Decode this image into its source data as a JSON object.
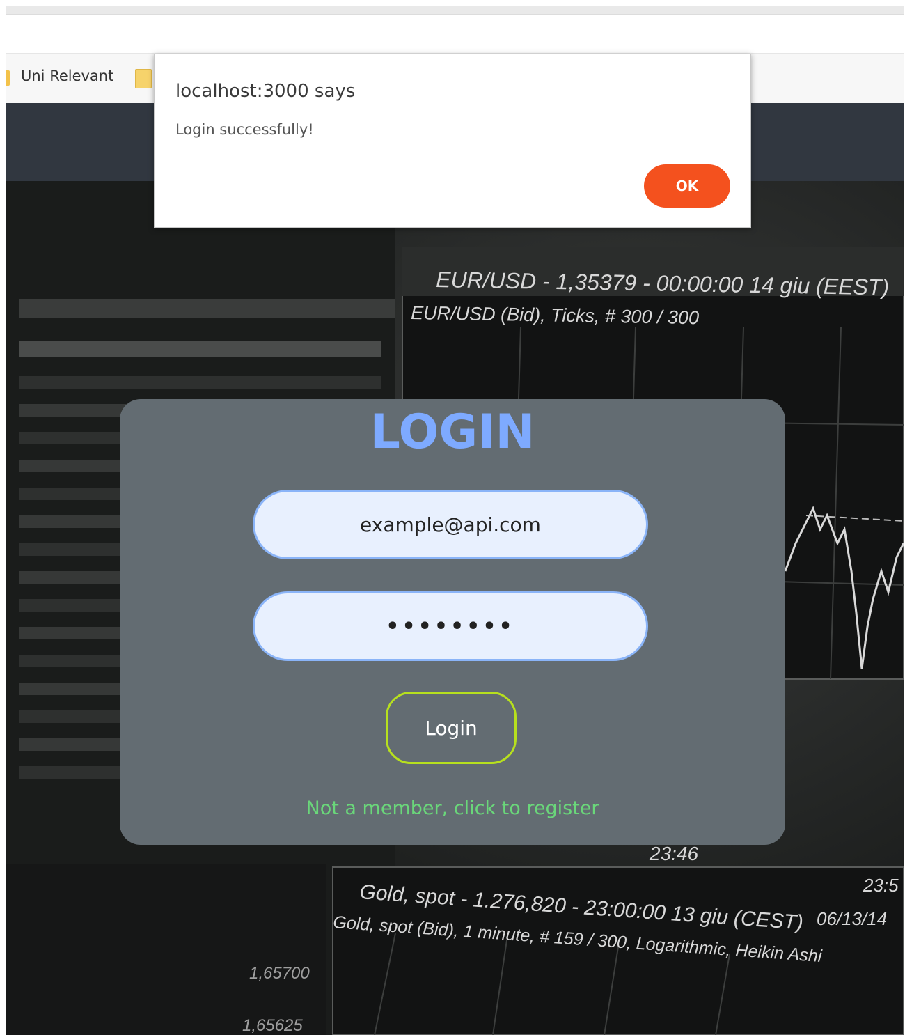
{
  "bookmarks": {
    "label": "Uni Relevant"
  },
  "background": {
    "chart1_title": "EUR/USD - 1,35379 - 00:00:00  14 giu (EEST)",
    "chart1_subtitle": "EUR/USD (Bid), Ticks, # 300 / 300",
    "time_label": "23:46",
    "date_label": "06/13/14",
    "time_label2": "23:5",
    "chart2_title": "Gold, spot - 1.276,820 - 23:00:00  13 giu (CEST)",
    "chart2_subtitle": "Gold, spot (Bid), 1 minute, # 159 / 300, Logarithmic, Heikin Ashi",
    "price1": "1,65700",
    "price2": "1,65625"
  },
  "dialog": {
    "title": "localhost:3000 says",
    "message": "Login successfully!",
    "ok_label": "OK"
  },
  "login": {
    "title": "LOGIN",
    "email_value": "example@api.com",
    "password_mask": "••••••••",
    "button_label": "Login",
    "register_link": "Not a member, click to register"
  },
  "colors": {
    "header_bg": "#313740",
    "card_bg": "#636c72",
    "title": "#7eaaff",
    "ok_button": "#f4511e",
    "login_border": "#b7e01e",
    "register_link": "#6ad77a"
  }
}
